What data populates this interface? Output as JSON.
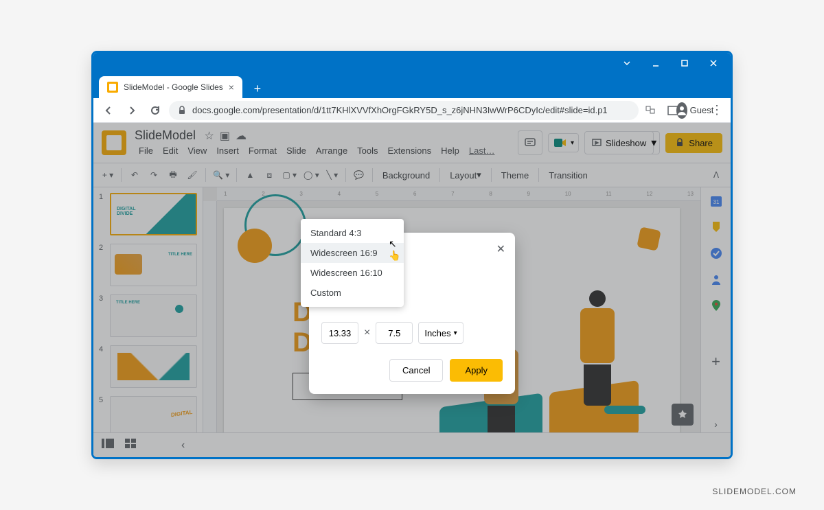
{
  "window": {
    "tab_title": "SlideModel - Google Slides",
    "url": "docs.google.com/presentation/d/1tt7KHlXVVfXhOrgFGkRY5D_s_z6jNHN3IwWrP6CDyIc/edit#slide=id.p1",
    "guest_label": "Guest"
  },
  "app": {
    "doc_name": "SlideModel",
    "menus": [
      "File",
      "Edit",
      "View",
      "Insert",
      "Format",
      "Slide",
      "Arrange",
      "Tools",
      "Extensions",
      "Help"
    ],
    "last_edit": "Last…",
    "slideshow_label": "Slideshow",
    "share_label": "Share"
  },
  "toolbar": {
    "background": "Background",
    "layout": "Layout",
    "theme": "Theme",
    "transition": "Transition"
  },
  "filmstrip": {
    "slides": [
      {
        "num": "1"
      },
      {
        "num": "2"
      },
      {
        "num": "3"
      },
      {
        "num": "4"
      },
      {
        "num": "5"
      }
    ]
  },
  "dialog": {
    "options": [
      "Standard 4:3",
      "Widescreen 16:9",
      "Widescreen 16:10",
      "Custom"
    ],
    "width": "13.33",
    "height": "7.5",
    "unit": "Inches",
    "cancel": "Cancel",
    "apply": "Apply"
  },
  "slide": {
    "text_line1_a": "D",
    "text_line2_a": "D"
  },
  "watermark": "SLIDEMODEL.COM"
}
